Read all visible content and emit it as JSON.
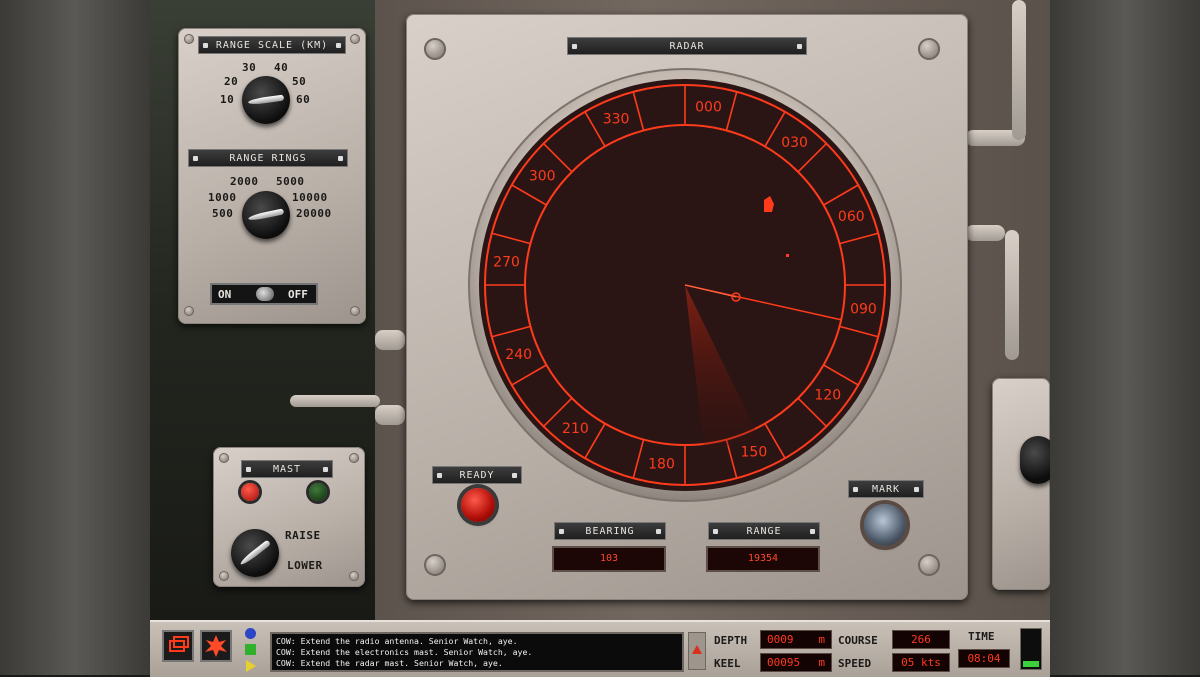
{
  "range_scale": {
    "title": "RANGE SCALE (KM)",
    "values": [
      "30",
      "40",
      "20",
      "50",
      "10",
      "60"
    ]
  },
  "range_rings": {
    "title": "RANGE RINGS",
    "values": [
      "2000",
      "5000",
      "1000",
      "10000",
      "500",
      "20000"
    ]
  },
  "power_switch": {
    "on_label": "ON",
    "off_label": "OFF"
  },
  "mast": {
    "title": "MAST",
    "raise_label": "RAISE",
    "lower_label": "LOWER"
  },
  "radar": {
    "title": "RADAR",
    "bearings": [
      "000",
      "030",
      "060",
      "090",
      "120",
      "150",
      "180",
      "210",
      "240",
      "270",
      "300",
      "330"
    ]
  },
  "ready": {
    "label": "READY"
  },
  "bearing": {
    "label": "BEARING",
    "value": "103"
  },
  "range": {
    "label": "RANGE",
    "value": "19354"
  },
  "mark": {
    "label": "MARK"
  },
  "messages": [
    "COW: Extend the radio antenna. Senior Watch, aye.",
    "COW: Extend the electronics mast. Senior Watch, aye.",
    "COW: Extend the radar mast. Senior Watch, aye."
  ],
  "status": {
    "depth_label": "DEPTH",
    "depth_value": "0009",
    "depth_unit": "m",
    "keel_label": "KEEL",
    "keel_value": "00095",
    "keel_unit": "m",
    "course_label": "COURSE",
    "course_value": "266",
    "speed_label": "SPEED",
    "speed_value": "05 kts",
    "time_label": "TIME",
    "time_value": "08:04"
  },
  "colors": {
    "radar_red": "#ff3b1c",
    "scope_bg": "#2a1514",
    "panel": "#c7bdb4"
  }
}
